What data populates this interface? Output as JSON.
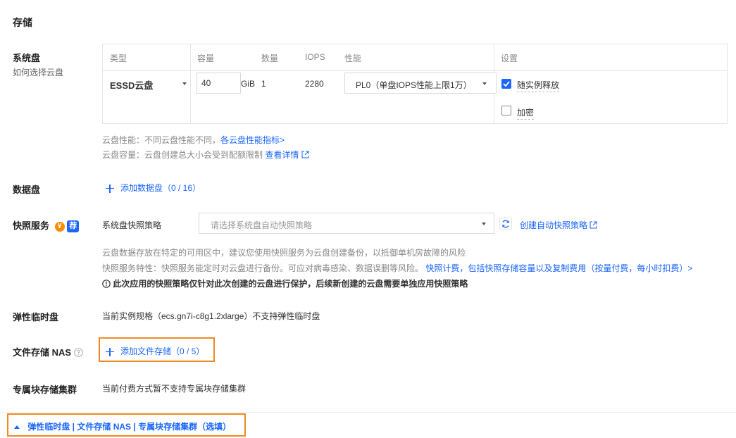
{
  "storage": {
    "title": "存储",
    "system_disk": {
      "label": "系统盘",
      "help_link": "如何选择云盘",
      "headers": {
        "type": "类型",
        "capacity": "容量",
        "count": "数量",
        "iops": "IOPS",
        "performance": "性能",
        "settings": "设置"
      },
      "type_value": "ESSD云盘",
      "capacity_value": "40",
      "capacity_unit": "GiB",
      "count_value": "1",
      "iops_value": "2280",
      "performance_value": "PL0（单盘IOPS性能上限1万）",
      "release_with_instance": {
        "label": "随实例释放",
        "checked": true
      },
      "encrypt": {
        "label": "加密",
        "checked": false
      },
      "note_perf_prefix": "云盘性能：不同云盘性能不同，",
      "note_perf_link": "各云盘性能指标>",
      "note_cap_prefix": "云盘容量：云盘创建总大小会受到配额限制",
      "note_cap_link": "查看详情"
    },
    "data_disk": {
      "label": "数据盘",
      "add_label": "添加数据盘（0 / 16）"
    },
    "snapshot": {
      "label": "快照服务",
      "badge_fee": "¥",
      "badge_save": "荐",
      "policy_label": "系统盘快照策略",
      "policy_placeholder": "请选择系统盘自动快照策略",
      "create_link": "创建自动快照策略",
      "note1": "云盘数据存放在特定的可用区中，建议您使用快照服务为云盘创建备份，以抵御单机房故障的风险",
      "note2_prefix": "快照服务特性：快照服务能定时对云盘进行备份。可应对病毒感染、数据误删等风险。",
      "note2_link": "快照计费，包括快照存储容量以及复制费用（按量付费，每小时扣费）>",
      "warning": "此次应用的快照策略仅针对此次创建的云盘进行保护，后续新创建的云盘需要单独应用快照策略"
    },
    "elastic_temp_disk": {
      "label": "弹性临时盘",
      "text": "当前实例规格（ecs.gn7i-c8g1.2xlarge）不支持弹性临时盘"
    },
    "nas": {
      "label": "文件存储 NAS",
      "add_label": "添加文件存储（0 / 5）"
    },
    "dedicated_block": {
      "label": "专属块存储集群",
      "text": "当前付费方式暂不支持专属块存储集群"
    },
    "collapse_bar": {
      "label": "弹性临时盘 | 文件存储 NAS | 专属块存储集群（选填）"
    }
  },
  "colors": {
    "accent": "#1a66ff",
    "highlight_border": "#f08a24",
    "fee_badge": "#ff8a00"
  }
}
